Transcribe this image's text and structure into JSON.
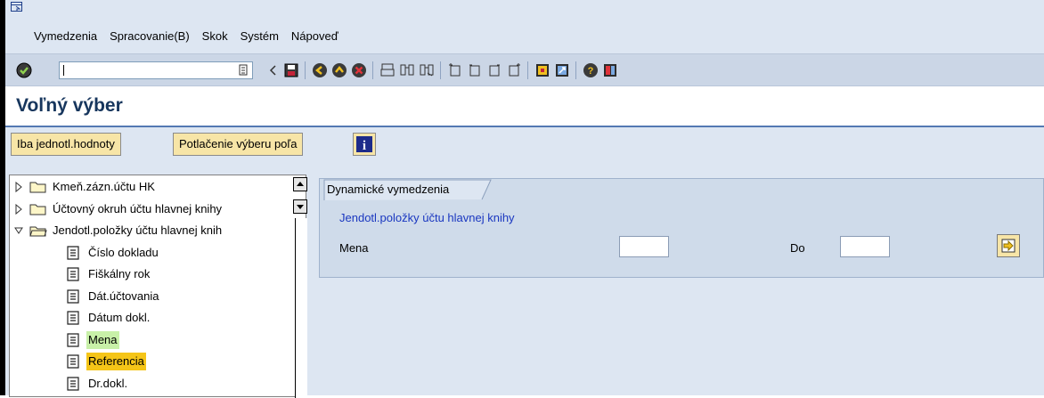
{
  "menubar": {
    "items": [
      "Vymedzenia",
      "Spracovanie(B)",
      "Skok",
      "Systém",
      "Nápoveď"
    ]
  },
  "toolbar": {
    "command_value": "",
    "icons": [
      "enter-icon",
      "back-icon",
      "save-icon",
      "back-nav-icon",
      "exit-icon",
      "cancel-icon",
      "print-icon",
      "find-icon",
      "find-next-icon",
      "first-page-icon",
      "prev-page-icon",
      "next-page-icon",
      "last-page-icon",
      "new-session-icon",
      "shortcut-icon",
      "help-icon",
      "layout-icon"
    ]
  },
  "page": {
    "title": "Voľný výber"
  },
  "app_toolbar": {
    "single_values_label": "Iba jednotl.hodnoty",
    "suppress_selection_label": "Potlačenie výberu poľa",
    "info_icon": "info-icon"
  },
  "tree": {
    "items": [
      {
        "label": "Kmeň.zázn.účtu HK",
        "type": "folder",
        "expanded": false,
        "highlight": ""
      },
      {
        "label": "Účtovný okruh účtu hlavnej knihy",
        "type": "folder",
        "expanded": false,
        "highlight": ""
      },
      {
        "label": "Jendotl.položky účtu hlavnej knih",
        "type": "folder",
        "expanded": true,
        "highlight": ""
      },
      {
        "label": "Číslo dokladu",
        "type": "field",
        "highlight": ""
      },
      {
        "label": "Fiškálny rok",
        "type": "field",
        "highlight": ""
      },
      {
        "label": "Dát.účtovania",
        "type": "field",
        "highlight": ""
      },
      {
        "label": "Dátum dokl.",
        "type": "field",
        "highlight": ""
      },
      {
        "label": "Mena",
        "type": "field",
        "highlight": "#c8f0a8"
      },
      {
        "label": "Referencia",
        "type": "field",
        "highlight": "#f5c518"
      },
      {
        "label": "Dr.dokl.",
        "type": "field",
        "highlight": ""
      }
    ]
  },
  "dynamic": {
    "tab_label": "Dynamické vymedzenia",
    "section_title": "Jendotl.položky účtu hlavnej knihy",
    "field_label": "Mena",
    "to_label": "Do",
    "from_value": "",
    "to_value": ""
  },
  "colors": {
    "accent": "#5479b3",
    "button_bg": "#f7e5a7",
    "panel_bg": "#dde6f2",
    "link_blue": "#1a37c0"
  }
}
